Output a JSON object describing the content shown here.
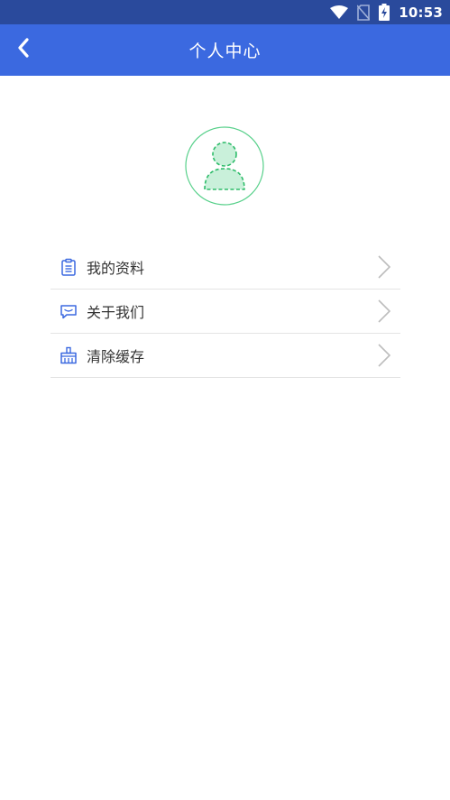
{
  "status_bar": {
    "time": "10:53",
    "icons": [
      "wifi-icon",
      "no-sim-icon",
      "battery-charging-icon"
    ]
  },
  "header": {
    "title": "个人中心",
    "back_icon": "chevron-left-icon"
  },
  "avatar": {
    "icon": "user-placeholder-icon",
    "accent": "#2ecc71"
  },
  "menu": {
    "items": [
      {
        "label": "我的资料",
        "icon": "clipboard-icon"
      },
      {
        "label": "关于我们",
        "icon": "chat-bubble-icon"
      },
      {
        "label": "清除缓存",
        "icon": "broom-icon"
      }
    ]
  },
  "colors": {
    "status_bar": "#2a4a9c",
    "header": "#3b69e0",
    "icon_blue": "#3b69e0",
    "chevron": "#bdbdbd",
    "divider": "#e3e3e3"
  }
}
